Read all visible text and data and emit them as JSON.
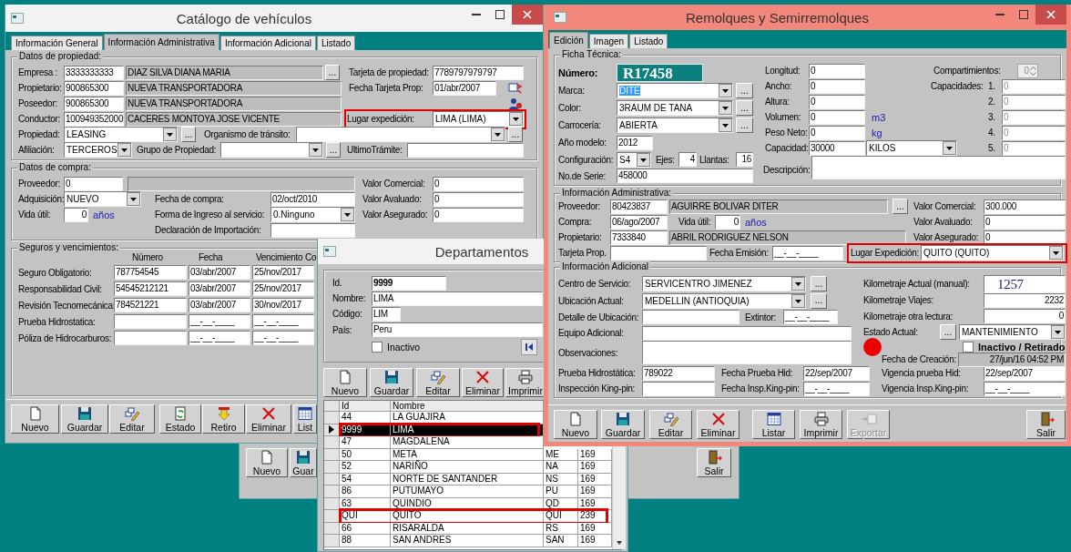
{
  "catalog_window": {
    "title": "Catálogo de vehículos",
    "tabs": [
      {
        "label": "Información General",
        "selected": false
      },
      {
        "label": "Información Administrativa",
        "selected": true
      },
      {
        "label": "Información Adicional",
        "selected": false
      },
      {
        "label": "Listado",
        "selected": false
      }
    ],
    "groups": [
      {
        "title": "Datos de propiedad:",
        "cols": [
          {
            "lines": [
              {
                "items": [
                  {
                    "kind": "label",
                    "text": "Empresa :"
                  },
                  {
                    "kind": "input",
                    "value": "3333333333"
                  },
                  {
                    "kind": "readonly",
                    "value": "DIAZ SILVA DIANA MARIA"
                  },
                  {
                    "kind": "dots",
                    "text": "..."
                  },
                  {
                    "kind": "label",
                    "text": "Tarjeta de propiedad:"
                  },
                  {
                    "kind": "input",
                    "value": "7789797979797"
                  }
                ]
              },
              {
                "items": [
                  {
                    "kind": "label",
                    "text": "Propietario:"
                  },
                  {
                    "kind": "input",
                    "value": "900865300"
                  },
                  {
                    "kind": "readonly",
                    "value": "NUEVA TRANSPORTADORA"
                  },
                  {
                    "kind": "label",
                    "text": "Fecha Tarjeta Prop:"
                  },
                  {
                    "kind": "input",
                    "value": "01/abr/2007"
                  },
                  {
                    "kind": "card_icon"
                  }
                ]
              },
              {
                "items": [
                  {
                    "kind": "label",
                    "text": "Poseedor:"
                  },
                  {
                    "kind": "input",
                    "value": "900865300"
                  },
                  {
                    "kind": "readonly",
                    "value": "NUEVA TRANSPORTADORA"
                  },
                  {
                    "kind": "person_icon"
                  }
                ]
              },
              {
                "items": [
                  {
                    "kind": "label",
                    "text": "Conductor:"
                  },
                  {
                    "kind": "input",
                    "value": "100949352000"
                  },
                  {
                    "kind": "readonly",
                    "value": "CACERES MONTOYA JOSE VICENTE"
                  },
                  {
                    "kind": "highlight",
                    "items": [
                      {
                        "kind": "label",
                        "text": "Lugar expedición:"
                      },
                      {
                        "kind": "combo",
                        "value": "LIMA  (LIMA)"
                      }
                    ]
                  }
                ]
              },
              {
                "items": [
                  {
                    "kind": "label",
                    "text": "Propiedad:"
                  },
                  {
                    "kind": "combo",
                    "value": "LEASING"
                  },
                  {
                    "kind": "dots",
                    "text": "..."
                  },
                  {
                    "kind": "label",
                    "text": "Organismo de tránsito:"
                  },
                  {
                    "kind": "combo"
                  },
                  {
                    "kind": "dots",
                    "text": "..."
                  }
                ]
              },
              {
                "items": [
                  {
                    "kind": "label",
                    "text": "Afiliación:"
                  },
                  {
                    "kind": "combo",
                    "value": "TERCEROS"
                  },
                  {
                    "kind": "label",
                    "text": "Grupo de Propiedad:"
                  },
                  {
                    "kind": "combo"
                  },
                  {
                    "kind": "dots",
                    "text": "..."
                  },
                  {
                    "kind": "label",
                    "text": "UltimoTrámite:"
                  },
                  {
                    "kind": "input"
                  }
                ]
              }
            ]
          }
        ]
      },
      {
        "title": "Datos de compra:",
        "cols": [
          {
            "lines": [
              {
                "items": [
                  {
                    "kind": "label",
                    "text": "Proveedor:"
                  },
                  {
                    "kind": "input",
                    "value": "0"
                  },
                  {
                    "kind": "readonly"
                  },
                  {
                    "kind": "label",
                    "text": "Valor Comercial:"
                  },
                  {
                    "kind": "input",
                    "value": "0"
                  }
                ]
              },
              {
                "items": [
                  {
                    "kind": "label",
                    "text": "Adquisición:"
                  },
                  {
                    "kind": "combo",
                    "value": "NUEVO"
                  },
                  {
                    "kind": "label",
                    "text": "Fecha de compra:"
                  },
                  {
                    "kind": "input",
                    "value": "02/oct/2010"
                  },
                  {
                    "kind": "label",
                    "text": "Valor Avaluado:"
                  },
                  {
                    "kind": "input",
                    "value": "0"
                  }
                ]
              },
              {
                "items": [
                  {
                    "kind": "label",
                    "text": "Vida útil:"
                  },
                  {
                    "kind": "number",
                    "value": "0"
                  },
                  {
                    "kind": "unit",
                    "text": "años"
                  },
                  {
                    "kind": "label",
                    "text": "Forma de Ingreso al servicio:"
                  },
                  {
                    "kind": "combo",
                    "value": "0.Ninguno"
                  },
                  {
                    "kind": "label",
                    "text": "Valor Asegurado:"
                  },
                  {
                    "kind": "input",
                    "value": "0"
                  }
                ]
              },
              {
                "items": [
                  {
                    "kind": "label",
                    "text": "Declaración de Importación:"
                  },
                  {
                    "kind": "input"
                  }
                ]
              }
            ]
          }
        ]
      },
      {
        "title": "Seguros y vencimientos:",
        "cols": [
          {
            "lines": [
              {
                "items": [
                  {
                    "kind": "caption",
                    "text": "Número"
                  },
                  {
                    "kind": "caption",
                    "text": "Fecha"
                  },
                  {
                    "kind": "caption",
                    "text": "Vencimiento"
                  },
                  {
                    "kind": "caption",
                    "text": "Co"
                  }
                ]
              },
              {
                "items": [
                  {
                    "kind": "label",
                    "text": "Seguro Obligatorio:"
                  },
                  {
                    "kind": "input",
                    "value": "787754545"
                  },
                  {
                    "kind": "input",
                    "value": "03/abr/2007"
                  },
                  {
                    "kind": "input",
                    "value": "25/nov/2017"
                  }
                ]
              },
              {
                "items": [
                  {
                    "kind": "label",
                    "text": "Responsabilidad Civil:"
                  },
                  {
                    "kind": "input",
                    "value": "54545212121"
                  },
                  {
                    "kind": "input",
                    "value": "03/abr/2007"
                  },
                  {
                    "kind": "input",
                    "value": "25/nov/2017"
                  }
                ]
              },
              {
                "items": [
                  {
                    "kind": "label",
                    "text": "Revisión Tecnomecánica:"
                  },
                  {
                    "kind": "input",
                    "value": "784521221"
                  },
                  {
                    "kind": "input",
                    "value": "03/abr/2007"
                  },
                  {
                    "kind": "input",
                    "value": "30/nov/2017"
                  }
                ]
              },
              {
                "items": [
                  {
                    "kind": "label",
                    "text": "Prueba Hidrostatica:"
                  },
                  {
                    "kind": "input"
                  },
                  {
                    "kind": "input",
                    "value": "__-__-____"
                  },
                  {
                    "kind": "input",
                    "value": "__-__-____"
                  }
                ]
              },
              {
                "items": [
                  {
                    "kind": "label",
                    "text": "Póliza de Hidrocarburos:"
                  },
                  {
                    "kind": "input"
                  },
                  {
                    "kind": "input",
                    "value": "__-__-____"
                  },
                  {
                    "kind": "input",
                    "value": "__-__-____"
                  }
                ]
              }
            ]
          }
        ]
      }
    ],
    "toolbar": [
      {
        "kind": "new",
        "label": "Nuevo"
      },
      {
        "kind": "save",
        "label": "Guardar"
      },
      {
        "kind": "edit",
        "label": "Editar"
      },
      {
        "kind": "status",
        "label": "Estado"
      },
      {
        "kind": "withdraw",
        "label": "Retiro"
      },
      {
        "kind": "delete",
        "label": "Eliminar"
      },
      {
        "kind": "list",
        "label": "List"
      }
    ]
  },
  "background_window": {
    "toolbar": [
      {
        "kind": "new",
        "label": "Nuevo"
      },
      {
        "kind": "save",
        "label": "Guar"
      },
      {
        "kind": "exit",
        "label": "Salir"
      }
    ]
  },
  "departments_window": {
    "title": "Departamentos",
    "form": {
      "lines": [
        {
          "items": [
            {
              "kind": "label",
              "text": "Id."
            },
            {
              "kind": "input_strong",
              "value": "9999"
            }
          ]
        },
        {
          "items": [
            {
              "kind": "label",
              "text": "Nombre:"
            },
            {
              "kind": "input",
              "value": "LIMA"
            }
          ]
        },
        {
          "items": [
            {
              "kind": "label",
              "text": "Código:"
            },
            {
              "kind": "input",
              "value": "LIM"
            }
          ]
        },
        {
          "items": [
            {
              "kind": "label",
              "text": "País:"
            },
            {
              "kind": "input",
              "value": "Peru"
            }
          ]
        },
        {
          "items": [
            {
              "kind": "check",
              "text": "Inactivo",
              "checked": false
            },
            {
              "kind": "nav_first"
            }
          ]
        }
      ]
    },
    "toolbar": [
      {
        "kind": "new",
        "label": "Nuevo"
      },
      {
        "kind": "save",
        "label": "Guardar"
      },
      {
        "kind": "edit",
        "label": "Editar"
      },
      {
        "kind": "delete",
        "label": "Eliminar"
      },
      {
        "kind": "print",
        "label": "Imprimir"
      }
    ],
    "grid": {
      "columns": [
        "Id",
        "Nombre"
      ],
      "rows": [
        {
          "cells": [
            "44",
            "LA GUAJIRA"
          ],
          "selected": false,
          "highlighted": false
        },
        {
          "cells": [
            "9999",
            "LIMA"
          ],
          "selected": true,
          "highlighted": true
        },
        {
          "cells": [
            "47",
            "MAGDALENA"
          ],
          "selected": false,
          "highlighted": false
        },
        {
          "cells": [
            "50",
            "META",
            "ME",
            "169"
          ],
          "selected": false,
          "highlighted": false
        },
        {
          "cells": [
            "52",
            "NARIÑO",
            "NA",
            "169"
          ],
          "selected": false,
          "highlighted": false
        },
        {
          "cells": [
            "54",
            "NORTE DE SANTANDER",
            "NS",
            "169"
          ],
          "selected": false,
          "highlighted": false
        },
        {
          "cells": [
            "86",
            "PUTUMAYO",
            "PU",
            "169"
          ],
          "selected": false,
          "highlighted": false
        },
        {
          "cells": [
            "63",
            "QUINDIO",
            "QD",
            "169"
          ],
          "selected": false,
          "highlighted": false
        },
        {
          "cells": [
            "QUI",
            "QUITO",
            "QUI",
            "239"
          ],
          "selected": false,
          "highlighted": true
        },
        {
          "cells": [
            "66",
            "RISARALDA",
            "RS",
            "169"
          ],
          "selected": false,
          "highlighted": false
        },
        {
          "cells": [
            "88",
            "SAN ANDRES",
            "SAN",
            "169"
          ],
          "selected": false,
          "highlighted": false
        }
      ]
    }
  },
  "trailers_window": {
    "title": "Remolques y Semirremolques",
    "tabs": [
      {
        "label": "Edición",
        "selected": true
      },
      {
        "label": "Imagen",
        "selected": false
      },
      {
        "label": "Listado",
        "selected": false
      }
    ],
    "groups": [
      {
        "title": "Ficha Técnica:",
        "cols": [
          {
            "lines": [
              {
                "items": [
                  {
                    "kind": "strong",
                    "text": "Número:"
                  },
                  {
                    "kind": "plate",
                    "value": "R17458"
                  }
                ]
              },
              {
                "items": [
                  {
                    "kind": "label",
                    "text": "Marca:"
                  },
                  {
                    "kind": "combo_sel",
                    "value": "DITE"
                  },
                  {
                    "kind": "dots",
                    "text": "..."
                  }
                ]
              },
              {
                "items": [
                  {
                    "kind": "label",
                    "text": "Color:"
                  },
                  {
                    "kind": "combo",
                    "value": "3RAUM DE TANA"
                  },
                  {
                    "kind": "dots",
                    "text": "..."
                  }
                ]
              },
              {
                "items": [
                  {
                    "kind": "label",
                    "text": "Carrocería:"
                  },
                  {
                    "kind": "combo",
                    "value": "ABIERTA"
                  },
                  {
                    "kind": "dots",
                    "text": "..."
                  }
                ]
              },
              {
                "items": [
                  {
                    "kind": "label",
                    "text": "Año modelo:"
                  },
                  {
                    "kind": "input",
                    "value": "2012"
                  }
                ]
              },
              {
                "items": [
                  {
                    "kind": "label",
                    "text": "Configuración:"
                  },
                  {
                    "kind": "combo",
                    "value": "S4"
                  },
                  {
                    "kind": "label",
                    "text": "Ejes:"
                  },
                  {
                    "kind": "number",
                    "value": "4"
                  },
                  {
                    "kind": "label",
                    "text": "Llantas:"
                  },
                  {
                    "kind": "number",
                    "value": "16"
                  }
                ]
              },
              {
                "items": [
                  {
                    "kind": "label",
                    "text": "No.de Serie:"
                  },
                  {
                    "kind": "input",
                    "value": "458000"
                  }
                ]
              }
            ]
          },
          {
            "lines": [
              {
                "items": [
                  {
                    "kind": "label",
                    "text": "Longitud:"
                  },
                  {
                    "kind": "input",
                    "value": "0"
                  }
                ]
              },
              {
                "items": [
                  {
                    "kind": "label",
                    "text": "Ancho:"
                  },
                  {
                    "kind": "input",
                    "value": "0"
                  }
                ]
              },
              {
                "items": [
                  {
                    "kind": "label",
                    "text": "Altura:"
                  },
                  {
                    "kind": "input",
                    "value": "0"
                  }
                ]
              },
              {
                "items": [
                  {
                    "kind": "label",
                    "text": "Volumen:"
                  },
                  {
                    "kind": "input",
                    "value": "0"
                  },
                  {
                    "kind": "unit",
                    "text": "m3"
                  }
                ]
              },
              {
                "items": [
                  {
                    "kind": "label",
                    "text": "Peso Neto:"
                  },
                  {
                    "kind": "input",
                    "value": "0"
                  },
                  {
                    "kind": "unit",
                    "text": "kg"
                  }
                ]
              },
              {
                "items": [
                  {
                    "kind": "label",
                    "text": "Capacidad:"
                  },
                  {
                    "kind": "input",
                    "value": "30000"
                  },
                  {
                    "kind": "combo",
                    "value": "KILOS"
                  }
                ]
              },
              {
                "items": [
                  {
                    "kind": "label",
                    "text": "Descripción:"
                  },
                  {
                    "kind": "memo"
                  }
                ]
              }
            ]
          },
          {
            "lines": [
              {
                "items": [
                  {
                    "kind": "label",
                    "text": "Compartimientos:"
                  },
                  {
                    "kind": "spin",
                    "value": "0"
                  }
                ]
              },
              {
                "items": [
                  {
                    "kind": "label",
                    "text": "Capacidades:"
                  },
                  {
                    "kind": "label",
                    "text": "1."
                  },
                  {
                    "kind": "dim",
                    "value": "0"
                  }
                ]
              },
              {
                "items": [
                  {
                    "kind": "label",
                    "text": "2."
                  },
                  {
                    "kind": "dim",
                    "value": "0"
                  }
                ]
              },
              {
                "items": [
                  {
                    "kind": "label",
                    "text": "3."
                  },
                  {
                    "kind": "dim",
                    "value": "0"
                  }
                ]
              },
              {
                "items": [
                  {
                    "kind": "label",
                    "text": "4."
                  },
                  {
                    "kind": "dim",
                    "value": "0"
                  }
                ]
              },
              {
                "items": [
                  {
                    "kind": "label",
                    "text": "5."
                  },
                  {
                    "kind": "dim",
                    "value": "0"
                  }
                ]
              }
            ]
          }
        ]
      },
      {
        "title": "Información Administrativa:",
        "cols": [
          {
            "lines": [
              {
                "items": [
                  {
                    "kind": "label",
                    "text": "Proveedor:"
                  },
                  {
                    "kind": "input",
                    "value": "80423837"
                  },
                  {
                    "kind": "readonly",
                    "value": "AGUIRRE BOLIVAR DITER"
                  },
                  {
                    "kind": "dots",
                    "text": "..."
                  },
                  {
                    "kind": "label",
                    "text": "Valor Comercial:"
                  },
                  {
                    "kind": "input",
                    "value": "300.000"
                  }
                ]
              },
              {
                "items": [
                  {
                    "kind": "label",
                    "text": "Compra:"
                  },
                  {
                    "kind": "input",
                    "value": "06/ago/2007"
                  },
                  {
                    "kind": "label",
                    "text": "Vida útil:"
                  },
                  {
                    "kind": "number",
                    "value": "0"
                  },
                  {
                    "kind": "unit",
                    "text": "años"
                  },
                  {
                    "kind": "label",
                    "text": "Valor Avaluado:"
                  },
                  {
                    "kind": "input",
                    "value": "0"
                  }
                ]
              },
              {
                "items": [
                  {
                    "kind": "label",
                    "text": "Propietario:"
                  },
                  {
                    "kind": "input",
                    "value": "7333840"
                  },
                  {
                    "kind": "readonly",
                    "value": "ABRIL RODRIGUEZ NELSON"
                  },
                  {
                    "kind": "label",
                    "text": "Valor Asegurado:"
                  },
                  {
                    "kind": "input",
                    "value": "0"
                  }
                ]
              },
              {
                "items": [
                  {
                    "kind": "label",
                    "text": "Tarjeta Prop."
                  },
                  {
                    "kind": "input"
                  },
                  {
                    "kind": "label",
                    "text": "Fecha Emisión:"
                  },
                  {
                    "kind": "input",
                    "value": "__-__-____"
                  },
                  {
                    "kind": "highlight",
                    "items": [
                      {
                        "kind": "label",
                        "text": "Lugar Expedición:"
                      },
                      {
                        "kind": "combo",
                        "value": "QUITO  (QUITO)"
                      }
                    ]
                  }
                ]
              }
            ]
          }
        ]
      },
      {
        "title": "Información Adicional",
        "cols": [
          {
            "lines": [
              {
                "items": [
                  {
                    "kind": "label",
                    "text": "Centro de Servicio:"
                  },
                  {
                    "kind": "combo",
                    "value": "SERVICENTRO JIMENEZ"
                  },
                  {
                    "kind": "dots",
                    "text": "..."
                  }
                ]
              },
              {
                "items": [
                  {
                    "kind": "label",
                    "text": "Ubicación Actual:"
                  },
                  {
                    "kind": "combo",
                    "value": "MEDELLIN  (ANTIOQUIA)"
                  },
                  {
                    "kind": "dots",
                    "text": "..."
                  }
                ]
              },
              {
                "items": [
                  {
                    "kind": "label",
                    "text": "Detalle de Ubicación:"
                  },
                  {
                    "kind": "input"
                  },
                  {
                    "kind": "label",
                    "text": "Extintor:"
                  },
                  {
                    "kind": "input",
                    "value": "__-__-____"
                  }
                ]
              },
              {
                "items": [
                  {
                    "kind": "label",
                    "text": "Equipo Adicional:"
                  },
                  {
                    "kind": "input"
                  }
                ]
              },
              {
                "items": [
                  {
                    "kind": "label",
                    "text": "Observaciones:"
                  },
                  {
                    "kind": "memo"
                  }
                ]
              },
              {
                "items": [
                  {
                    "kind": "label",
                    "text": "Prueba Hidrostática:"
                  },
                  {
                    "kind": "input",
                    "value": "789022"
                  },
                  {
                    "kind": "label",
                    "text": "Fecha Prueba Hid:"
                  },
                  {
                    "kind": "input",
                    "value": "22/sep/2007"
                  },
                  {
                    "kind": "label",
                    "text": "Vigencia prueba Hid:"
                  },
                  {
                    "kind": "input",
                    "value": "22/sep/2007"
                  }
                ]
              },
              {
                "items": [
                  {
                    "kind": "label",
                    "text": "Inspección King-pin:"
                  },
                  {
                    "kind": "input"
                  },
                  {
                    "kind": "label",
                    "text": "Fecha Insp.King-pin:"
                  },
                  {
                    "kind": "input",
                    "value": "__-__-____"
                  },
                  {
                    "kind": "label",
                    "text": "Vigencia Insp.King-pin:"
                  },
                  {
                    "kind": "input",
                    "value": "__-__-____"
                  }
                ]
              }
            ]
          },
          {
            "lines": [
              {
                "items": [
                  {
                    "kind": "label",
                    "text": "Kilometraje Actual (manual):"
                  },
                  {
                    "kind": "odometer",
                    "value": "1257"
                  }
                ]
              },
              {
                "items": [
                  {
                    "kind": "label",
                    "text": "Kilometraje Viajes:"
                  },
                  {
                    "kind": "number",
                    "value": "2232"
                  }
                ]
              },
              {
                "items": [
                  {
                    "kind": "label",
                    "text": "Kilometraje otra lectura:"
                  },
                  {
                    "kind": "number",
                    "value": "0"
                  }
                ]
              },
              {
                "items": [
                  {
                    "kind": "label",
                    "text": "Estado Actual:"
                  },
                  {
                    "kind": "dots",
                    "text": "..."
                  },
                  {
                    "kind": "combo",
                    "value": "MANTENIMIENTO"
                  }
                ]
              },
              {
                "items": [
                  {
                    "kind": "dot"
                  },
                  {
                    "kind": "check_strong",
                    "text": "Inactivo / Retirado",
                    "checked": false
                  }
                ]
              },
              {
                "items": [
                  {
                    "kind": "label",
                    "text": "Fecha de Creación:"
                  },
                  {
                    "kind": "readonly_num",
                    "value": "27/jun/16 04:52 PM"
                  }
                ]
              }
            ]
          }
        ]
      }
    ],
    "toolbar": [
      {
        "kind": "new",
        "label": "Nuevo",
        "disabled": false
      },
      {
        "kind": "save",
        "label": "Guardar",
        "disabled": false
      },
      {
        "kind": "edit",
        "label": "Editar",
        "disabled": false
      },
      {
        "kind": "delete",
        "label": "Eliminar",
        "disabled": false
      },
      {
        "kind": "list",
        "label": "Listar",
        "disabled": false
      },
      {
        "kind": "print",
        "label": "Imprimir",
        "disabled": false
      },
      {
        "kind": "export",
        "label": "Exportar",
        "disabled": true
      },
      {
        "kind": "exit",
        "label": "Salir",
        "disabled": false
      }
    ]
  }
}
